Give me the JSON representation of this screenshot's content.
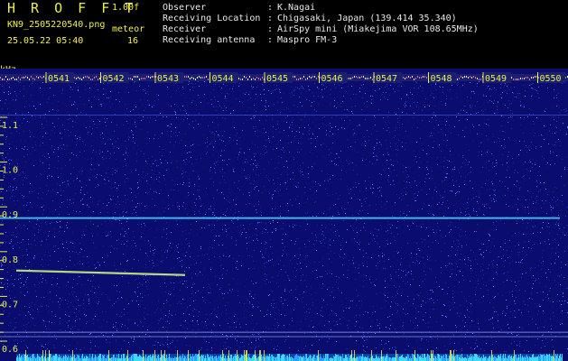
{
  "header": {
    "app_title": "H R O F F T",
    "version": "1.00f",
    "file_name": "KN9_2505220540.png",
    "meteor_label": "meteor",
    "datetime": "25.05.22 05:40",
    "meteor_count": "16"
  },
  "station": [
    {
      "key": "Observer",
      "value": "K.Nagai"
    },
    {
      "key": "Receiving Location",
      "value": "Chigasaki, Japan (139.414 35.340)"
    },
    {
      "key": "Receiver",
      "value": "AirSpy mini (Miakejima VOR 108.65MHz)"
    },
    {
      "key": "Receiving antenna",
      "value": "Maspro FM-3"
    }
  ],
  "separator": ":",
  "plot": {
    "unit_label": "kHz",
    "y_ticks": [
      "1.1",
      "1.0",
      "0.9",
      "0.8",
      "0.7",
      "0.6"
    ],
    "time_labels": [
      "0541",
      "0542",
      "0543",
      "0544",
      "0545",
      "0546",
      "0547",
      "0548",
      "0549",
      "0550"
    ],
    "colors": {
      "background": "#0a0d6e",
      "noise": "#3b5cff",
      "carrier": "#4fd0ff",
      "meteor": "#c8f070",
      "text": "#e9f04a"
    }
  }
}
